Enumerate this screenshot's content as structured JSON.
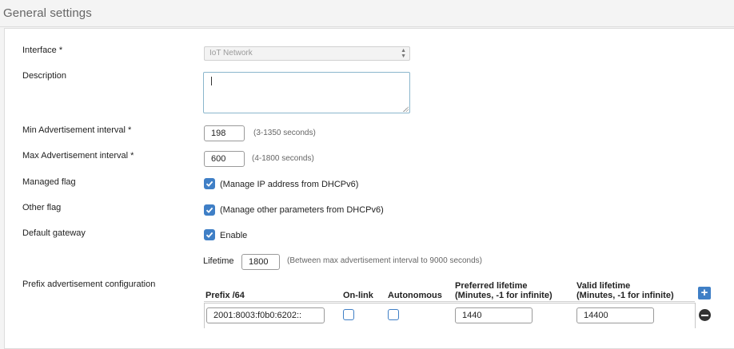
{
  "section": {
    "title": "General settings"
  },
  "fields": {
    "interface": {
      "label": "Interface *",
      "value": "IoT Network"
    },
    "description": {
      "label": "Description",
      "value": ""
    },
    "min_adv": {
      "label": "Min Advertisement interval *",
      "value": "198",
      "hint": "(3-1350 seconds)"
    },
    "max_adv": {
      "label": "Max Advertisement interval *",
      "value": "600",
      "hint": "(4-1800 seconds)"
    },
    "managed_flag": {
      "label": "Managed flag",
      "checked": true,
      "text": "(Manage IP address from DHCPv6)"
    },
    "other_flag": {
      "label": "Other flag",
      "checked": true,
      "text": "(Manage other parameters from DHCPv6)"
    },
    "default_gateway": {
      "label": "Default gateway",
      "checked": true,
      "text": "Enable"
    },
    "lifetime": {
      "label": "Lifetime",
      "value": "1800",
      "hint": "(Between max advertisement interval to 9000 seconds)"
    }
  },
  "prefix_config": {
    "label": "Prefix advertisement configuration",
    "columns": {
      "prefix": "Prefix /64",
      "on_link": "On-link",
      "autonomous": "Autonomous",
      "preferred_l1": "Preferred lifetime",
      "preferred_l2": "(Minutes, -1 for infinite)",
      "valid_l1": "Valid lifetime",
      "valid_l2": "(Minutes, -1 for infinite)"
    },
    "rows": [
      {
        "prefix": "2001:8003:f0b0:6202::",
        "on_link": false,
        "autonomous": false,
        "preferred": "1440",
        "valid": "14400"
      }
    ]
  },
  "colors": {
    "accent": "#3f7fc6",
    "label_text": "#222222",
    "hint_text": "#666666"
  },
  "icons": {
    "add": "plus-square-icon",
    "remove": "minus-circle-icon",
    "check": "check-icon",
    "select_arrows": "updown-arrows-icon"
  }
}
